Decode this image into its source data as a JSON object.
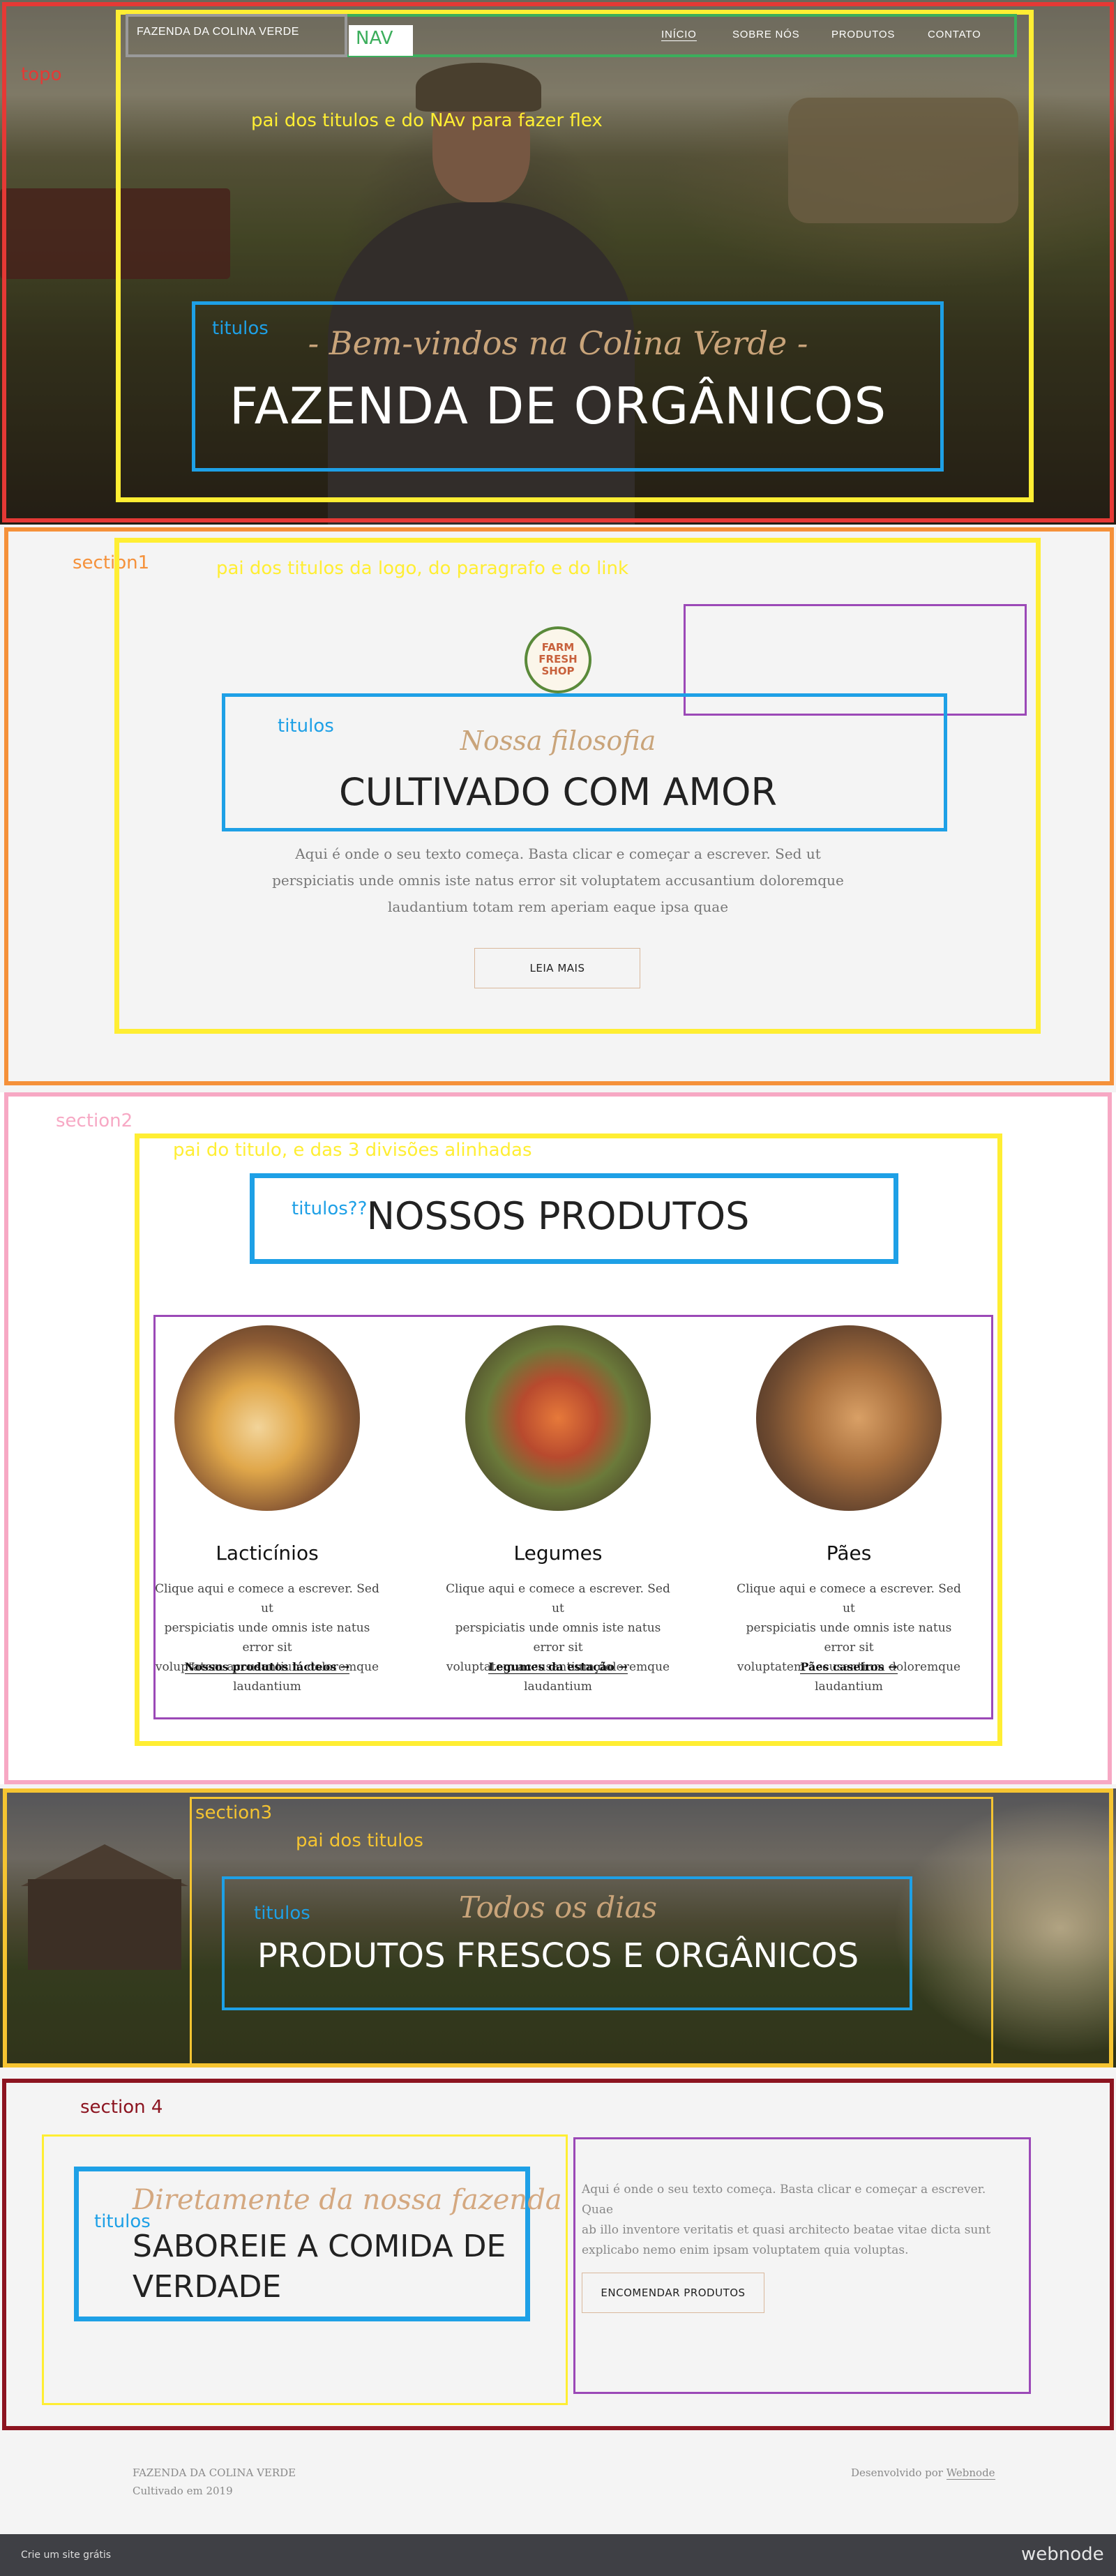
{
  "nav": {
    "brand": "FAZENDA DA COLINA VERDE",
    "links": [
      "INÍCIO",
      "SOBRE NÓS",
      "PRODUTOS",
      "CONTATO"
    ]
  },
  "hero": {
    "subtitle": "- Bem-vindos na Colina Verde -",
    "title": "FAZENDA DE ORGÂNICOS"
  },
  "section1": {
    "logo_lines": [
      "FARM",
      "FRESH",
      "SHOP"
    ],
    "subtitle": "Nossa filosofia",
    "title": "CULTIVADO COM AMOR",
    "paragraph": [
      "Aqui é onde o seu texto começa. Basta clicar e começar a escrever. Sed ut",
      "perspiciatis unde omnis iste natus error sit voluptatem accusantium doloremque",
      "laudantium totam rem aperiam eaque ipsa quae"
    ],
    "button": "LEIA MAIS"
  },
  "section2": {
    "title": "NOSSOS PRODUTOS",
    "products": [
      {
        "name": "Lacticínios",
        "desc": [
          "Clique aqui e comece a escrever. Sed ut",
          "perspiciatis unde omnis iste natus error sit",
          "voluptatem accusantium doloremque",
          "laudantium"
        ],
        "link": "Nossos produtos lácteos →"
      },
      {
        "name": "Legumes",
        "desc": [
          "Clique aqui e comece a escrever. Sed ut",
          "perspiciatis unde omnis iste natus error sit",
          "voluptatem accusantium doloremque",
          "laudantium"
        ],
        "link": "Legumes da estação →"
      },
      {
        "name": "Pães",
        "desc": [
          "Clique aqui e comece a escrever. Sed ut",
          "perspiciatis unde omnis iste natus error sit",
          "voluptatem accusantium doloremque",
          "laudantium"
        ],
        "link": "Pães caseiros →"
      }
    ]
  },
  "section3": {
    "subtitle": "Todos os dias",
    "title": "PRODUTOS FRESCOS E ORGÂNICOS"
  },
  "section4": {
    "subtitle": "Diretamente da nossa fazenda",
    "title": [
      "SABOREIE A COMIDA DE",
      "VERDADE"
    ],
    "paragraph": [
      "Aqui é onde o seu texto começa. Basta clicar e começar a escrever. Quae",
      "ab illo inventore veritatis et quasi architecto beatae vitae dicta sunt",
      "explicabo nemo enim ipsam voluptatem quia voluptas."
    ],
    "button": "ENCOMENDAR PRODUTOS"
  },
  "footer": {
    "brand": "FAZENDA DA COLINA VERDE",
    "since": "Cultivado em 2019",
    "credit_prefix": "Desenvolvido por",
    "credit_link": "Webnode"
  },
  "bottombar": {
    "left": "Crie um site grátis",
    "right": "webnode"
  },
  "annotations": {
    "topo": "topo",
    "nav": "NAV",
    "hero_parent": "pai dos titulos e do NAv para fazer flex",
    "titulos": "titulos",
    "section1": "section1",
    "s1_parent": "pai dos titulos da logo, do paragrafo e do link",
    "section2": "section2",
    "s2_parent": "pai do titulo, e das 3 divisões alinhadas",
    "s2_titulos": "titulos??",
    "section3": "section3",
    "s3_parent": "pai dos titulos",
    "section4": "section 4"
  },
  "colors": {
    "topo": "#e53935",
    "nav": "#3cae5c",
    "parent": "#ffee33",
    "titulos": "#1ea0e6",
    "section1": "#f5913a",
    "section2": "#f7a8c4",
    "section3": "#f5c431",
    "section4": "#8c1420",
    "purple": "#9b49b7"
  }
}
